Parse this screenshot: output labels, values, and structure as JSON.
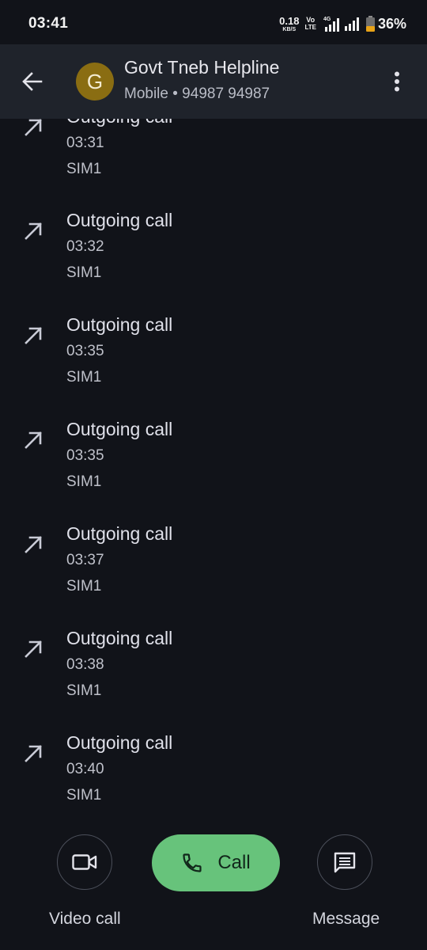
{
  "status_bar": {
    "time": "03:41",
    "net_speed_value": "0.18",
    "net_speed_unit": "KB/S",
    "volte_top": "Vo",
    "volte_bottom": "LTE",
    "network_type": "4G",
    "battery_percent": "36%",
    "battery_color": "#e8a317"
  },
  "header": {
    "avatar_letter": "G",
    "avatar_color": "#8a6d12",
    "contact_name": "Govt Tneb Helpline",
    "contact_subtitle": "Mobile • 94987 94987"
  },
  "calls": [
    {
      "type": "Outgoing call",
      "time": "03:31",
      "sim": "SIM1"
    },
    {
      "type": "Outgoing call",
      "time": "03:32",
      "sim": "SIM1"
    },
    {
      "type": "Outgoing call",
      "time": "03:35",
      "sim": "SIM1"
    },
    {
      "type": "Outgoing call",
      "time": "03:35",
      "sim": "SIM1"
    },
    {
      "type": "Outgoing call",
      "time": "03:37",
      "sim": "SIM1"
    },
    {
      "type": "Outgoing call",
      "time": "03:38",
      "sim": "SIM1"
    },
    {
      "type": "Outgoing call",
      "time": "03:40",
      "sim": "SIM1"
    }
  ],
  "actions": {
    "video_label": "Video call",
    "call_label": "Call",
    "message_label": "Message",
    "call_button_color": "#67c37b"
  },
  "icons": {
    "back": "arrow-left-icon",
    "more": "more-vert-icon",
    "call_direction": "arrow-outgoing-icon",
    "video": "videocam-icon",
    "phone": "phone-icon",
    "message": "message-icon"
  }
}
